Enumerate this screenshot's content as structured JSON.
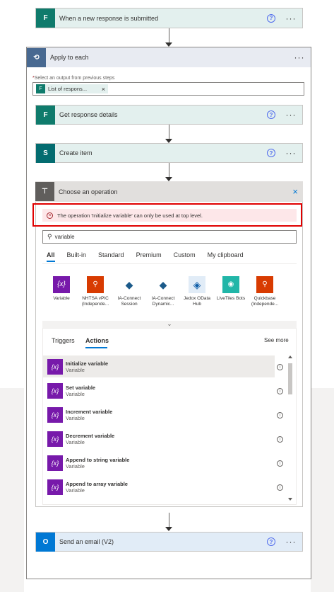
{
  "trigger": {
    "title": "When a new response is submitted",
    "help": "?",
    "more": "···"
  },
  "apply_each": {
    "title": "Apply to each",
    "more": "···",
    "select_label": "Select an output from previous steps",
    "required_mark": "*",
    "token_label": "List of respons...",
    "token_remove": "×"
  },
  "steps": {
    "get_response": {
      "title": "Get response details",
      "help": "?",
      "more": "···"
    },
    "create_item": {
      "title": "Create item",
      "help": "?",
      "more": "···"
    },
    "send_email": {
      "title": "Send an email (V2)",
      "help": "?",
      "more": "···"
    }
  },
  "choose_op": {
    "title": "Choose an operation",
    "close": "×",
    "error": "The operation 'Initialize variable' can only be used at top level.",
    "search_value": "variable",
    "tabs": [
      "All",
      "Built-in",
      "Standard",
      "Premium",
      "Custom",
      "My clipboard"
    ],
    "connectors": [
      {
        "label": "Variable",
        "color": "#7719aa",
        "glyph": "{x}"
      },
      {
        "label": "NHTSA vPIC (Independe...",
        "color": "#d83b01",
        "glyph": "⚲"
      },
      {
        "label": "IA-Connect Session",
        "color": "#ffffff",
        "glyph": "◆"
      },
      {
        "label": "IA-Connect Dynamic...",
        "color": "#ffffff",
        "glyph": "◆"
      },
      {
        "label": "Jedox OData Hub",
        "color": "#e1ecf7",
        "glyph": "◈"
      },
      {
        "label": "LiveTiles Bots",
        "color": "#21b6a8",
        "glyph": "◉"
      },
      {
        "label": "Quickbase (Independe...",
        "color": "#d83b01",
        "glyph": "⚲"
      }
    ],
    "expand": "⌄",
    "subtabs": {
      "triggers": "Triggers",
      "actions": "Actions",
      "see_more": "See more"
    },
    "actions": [
      {
        "name": "Initialize variable",
        "connector": "Variable"
      },
      {
        "name": "Set variable",
        "connector": "Variable"
      },
      {
        "name": "Increment variable",
        "connector": "Variable"
      },
      {
        "name": "Decrement variable",
        "connector": "Variable"
      },
      {
        "name": "Append to string variable",
        "connector": "Variable"
      },
      {
        "name": "Append to array variable",
        "connector": "Variable"
      }
    ],
    "action_icon": "{x}",
    "info": "i"
  }
}
